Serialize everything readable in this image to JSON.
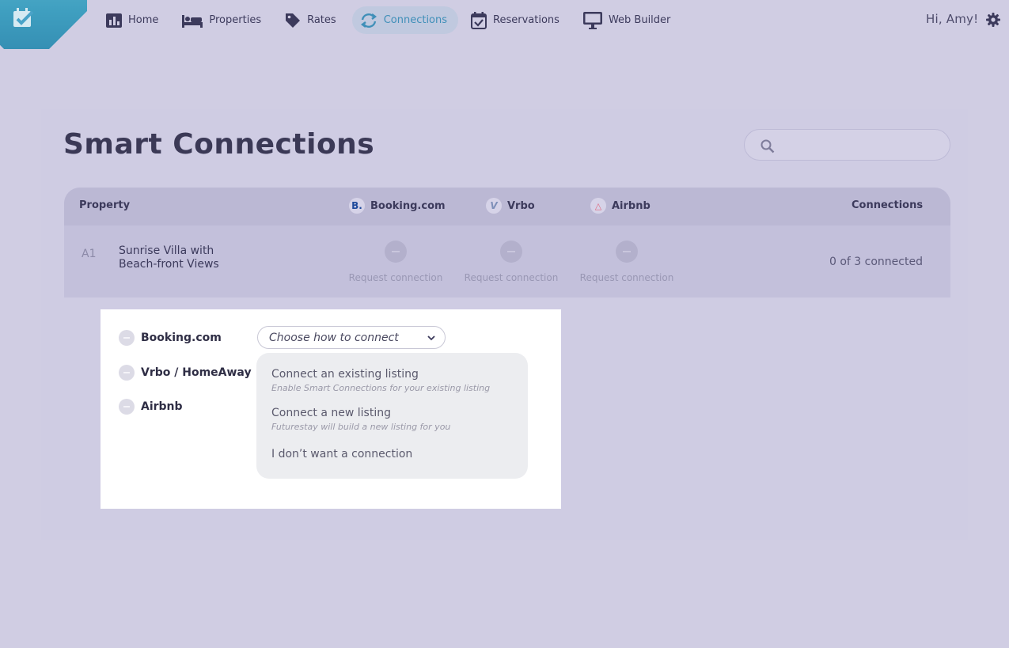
{
  "nav": {
    "items": [
      {
        "label": "Home",
        "icon": "bar-chart-icon"
      },
      {
        "label": "Properties",
        "icon": "bed-icon"
      },
      {
        "label": "Rates",
        "icon": "tag-icon"
      },
      {
        "label": "Connections",
        "icon": "sync-icon",
        "active": true
      },
      {
        "label": "Reservations",
        "icon": "calendar-check-icon"
      },
      {
        "label": "Web Builder",
        "icon": "monitor-icon"
      }
    ],
    "greeting": "Hi, Amy!"
  },
  "page": {
    "title": "Smart Connections",
    "search_placeholder": ""
  },
  "table": {
    "headers": {
      "property": "Property",
      "booking": "Booking.com",
      "vrbo": "Vrbo",
      "airbnb": "Airbnb",
      "connections": "Connections"
    },
    "logos": {
      "booking": "B.",
      "vrbo": "V",
      "airbnb": "△"
    },
    "rows": [
      {
        "id": "A1",
        "name": "Sunrise Villa with Beach-front Views",
        "booking": "Request connection",
        "vrbo": "Request connection",
        "airbnb": "Request connection",
        "connections": "0 of 3 connected"
      }
    ]
  },
  "panel": {
    "channels": [
      "Booking.com",
      "Vrbo / HomeAway",
      "Airbnb"
    ],
    "select_label": "Choose how to connect",
    "options": [
      {
        "title": "Connect an existing listing",
        "subtitle": "Enable Smart Connections for your existing listing"
      },
      {
        "title": "Connect a new listing",
        "subtitle": "Futurestay will build a new listing for you"
      },
      {
        "title": "I don’t want a connection",
        "subtitle": ""
      }
    ]
  },
  "colors": {
    "background": "#d0cde3",
    "accent": "#3f8fb8",
    "header_row": "#bbb8d4",
    "panel": "#ffffff"
  }
}
